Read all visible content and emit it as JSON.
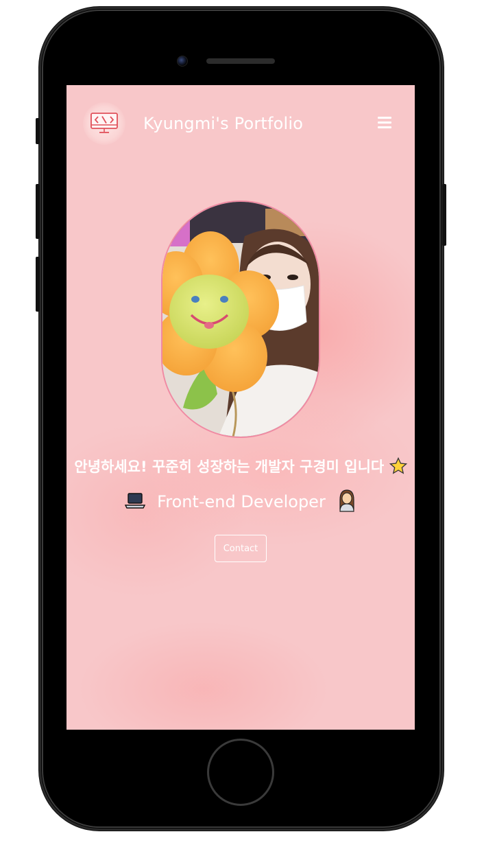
{
  "nav": {
    "brand": "Kyungmi's Portfolio",
    "logo_icon": "code-monitor-icon",
    "menu_icon": "hamburger-menu-icon"
  },
  "hero": {
    "greeting": "안녕하세요! 꾸준히 성장하는 개발자 구경미 입니다",
    "greeting_emoji": "⭐",
    "role_prefix_emoji": "💻",
    "role": "Front-end Developer",
    "role_suffix_emoji": "👩",
    "contact_label": "Contact"
  },
  "colors": {
    "background": "#f8c7c9",
    "accent_border": "#f08aa3",
    "text": "#ffffff"
  }
}
